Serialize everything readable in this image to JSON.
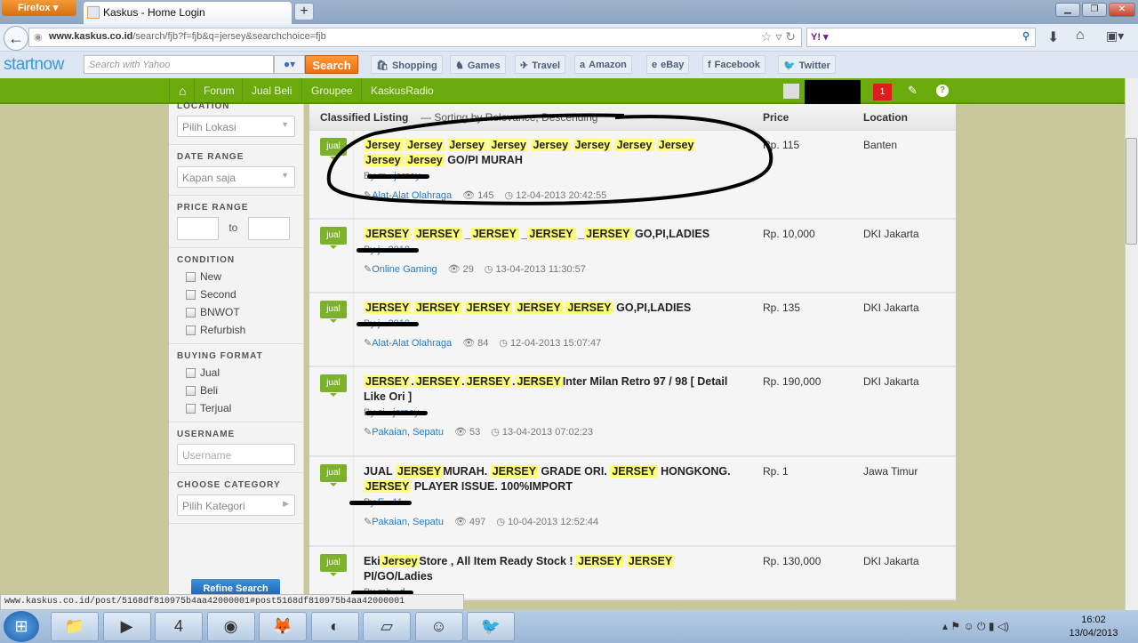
{
  "browser": {
    "menu_label": "Firefox",
    "tab_title": "Kaskus - Home Login",
    "new_tab": "+",
    "url_domain": "www.kaskus.co.id",
    "url_path": "/search/fjb?f=fjb&q=jersey&searchchoice=fjb",
    "search_engine": "Y!",
    "status_url": "www.kaskus.co.id/post/5168df810975b4aa42000001#post5168df810975b4aa42000001"
  },
  "toolbar": {
    "brand": "startnow",
    "search_placeholder": "Search with Yahoo",
    "search_button": "Search",
    "bookmarks": [
      {
        "label": "Shopping",
        "icon": "shopping-bag-icon"
      },
      {
        "label": "Games",
        "icon": "chess-knight-icon"
      },
      {
        "label": "Travel",
        "icon": "plane-icon"
      },
      {
        "label": "Amazon",
        "icon": "amazon-icon"
      },
      {
        "label": "eBay",
        "icon": "ebay-icon"
      },
      {
        "label": "Facebook",
        "icon": "facebook-icon"
      },
      {
        "label": "Twitter",
        "icon": "twitter-icon"
      }
    ]
  },
  "site_nav": {
    "items": [
      "Forum",
      "Jual Beli",
      "Groupee",
      "KaskusRadio"
    ],
    "notification_count": "1",
    "accent": "#6aaa0d"
  },
  "sidebar": {
    "location": {
      "label": "LOCATION",
      "value": "Pilih Lokasi"
    },
    "date_range": {
      "label": "DATE RANGE",
      "value": "Kapan saja"
    },
    "price_range": {
      "label": "PRICE RANGE",
      "to": "to",
      "min": "",
      "max": ""
    },
    "condition": {
      "label": "CONDITION",
      "options": [
        "New",
        "Second",
        "BNWOT",
        "Refurbish"
      ]
    },
    "buying_format": {
      "label": "BUYING FORMAT",
      "options": [
        "Jual",
        "Beli",
        "Terjual"
      ]
    },
    "username": {
      "label": "USERNAME",
      "placeholder": "Username"
    },
    "category": {
      "label": "CHOOSE CATEGORY",
      "value": "Pilih Kategori"
    },
    "refine_button": "Refine Search"
  },
  "listing": {
    "header": {
      "title": "Classified Listing",
      "sorting": "— Sorting by Relevance, Descending",
      "price": "Price",
      "location": "Location"
    },
    "by_label": "By",
    "items": [
      {
        "badge": "jual",
        "title": [
          {
            "t": "Jersey",
            "h": true
          },
          {
            "t": " "
          },
          {
            "t": "Jersey",
            "h": true
          },
          {
            "t": " "
          },
          {
            "t": "Jersey",
            "h": true
          },
          {
            "t": " "
          },
          {
            "t": "Jersey",
            "h": true
          },
          {
            "t": " "
          },
          {
            "t": "Jersey",
            "h": true
          },
          {
            "t": " "
          },
          {
            "t": "Jersey",
            "h": true
          },
          {
            "t": " "
          },
          {
            "t": "Jersey",
            "h": true
          },
          {
            "t": " "
          },
          {
            "t": "Jersey",
            "h": true
          },
          {
            "t": " "
          },
          {
            "t": "Jersey",
            "h": true
          },
          {
            "t": " "
          },
          {
            "t": "Jersey",
            "h": true
          },
          {
            "t": " GO/PI MURAH"
          }
        ],
        "seller": "m...jersey",
        "category": "Alat-Alat Olahraga",
        "views": "145",
        "date": "12-04-2013 20:42:55",
        "price": "Rp. 115",
        "location": "Banten"
      },
      {
        "badge": "jual",
        "title": [
          {
            "t": "JERSEY",
            "h": true
          },
          {
            "t": " "
          },
          {
            "t": "JERSEY",
            "h": true
          },
          {
            "t": " _"
          },
          {
            "t": "JERSEY",
            "h": true
          },
          {
            "t": " _"
          },
          {
            "t": "JERSEY",
            "h": true
          },
          {
            "t": " _"
          },
          {
            "t": "JERSEY",
            "h": true
          },
          {
            "t": " GO,PI,LADIES"
          }
        ],
        "seller": "j...2010",
        "category": "Online Gaming",
        "views": "29",
        "date": "13-04-2013 11:30:57",
        "price": "Rp. 10,000",
        "location": "DKI Jakarta"
      },
      {
        "badge": "jual",
        "title": [
          {
            "t": "JERSEY",
            "h": true
          },
          {
            "t": " "
          },
          {
            "t": "JERSEY",
            "h": true
          },
          {
            "t": " "
          },
          {
            "t": "JERSEY",
            "h": true
          },
          {
            "t": " "
          },
          {
            "t": "JERSEY",
            "h": true
          },
          {
            "t": " "
          },
          {
            "t": "JERSEY",
            "h": true
          },
          {
            "t": " GO,PI,LADIES"
          }
        ],
        "seller": "j...2010",
        "category": "Alat-Alat Olahraga",
        "views": "84",
        "date": "12-04-2013 15:07:47",
        "price": "Rp. 135",
        "location": "DKI Jakarta"
      },
      {
        "badge": "jual",
        "title": [
          {
            "t": "JERSEY",
            "h": true
          },
          {
            "t": "."
          },
          {
            "t": "JERSEY",
            "h": true
          },
          {
            "t": "."
          },
          {
            "t": "JERSEY",
            "h": true
          },
          {
            "t": "."
          },
          {
            "t": "JERSEY",
            "h": true
          },
          {
            "t": "Inter Milan Retro 97 / 98 [ Detail Like Ori ]"
          }
        ],
        "seller": "ci...jersey",
        "category": "Pakaian, Sepatu",
        "views": "53",
        "date": "13-04-2013 07:02:23",
        "price": "Rp. 190,000",
        "location": "DKI Jakarta"
      },
      {
        "badge": "jual",
        "title": [
          {
            "t": "JUAL "
          },
          {
            "t": "JERSEY",
            "h": true
          },
          {
            "t": "MURAH. "
          },
          {
            "t": "JERSEY",
            "h": true
          },
          {
            "t": " GRADE ORI. "
          },
          {
            "t": "JERSEY",
            "h": true
          },
          {
            "t": " HONGKONG. "
          },
          {
            "t": "JERSEY",
            "h": true
          },
          {
            "t": " PLAYER ISSUE. 100%IMPORT"
          }
        ],
        "seller": "E...11",
        "category": "Pakaian, Sepatu",
        "views": "497",
        "date": "10-04-2013 12:52:44",
        "price": "Rp. 1",
        "location": "Jawa Timur"
      },
      {
        "badge": "jual",
        "title": [
          {
            "t": "Eki"
          },
          {
            "t": "Jersey",
            "h": true
          },
          {
            "t": "Store , All Item Ready Stock ! "
          },
          {
            "t": "JERSEY",
            "h": true
          },
          {
            "t": " "
          },
          {
            "t": "JERSEY",
            "h": true
          },
          {
            "t": " PI/GO/Ladies"
          }
        ],
        "seller": "mb...d",
        "category": "",
        "views": "",
        "date": "",
        "price": "Rp. 130,000",
        "location": "DKI Jakarta"
      }
    ]
  },
  "taskbar": {
    "apps": [
      "file-explorer-icon",
      "media-player-icon",
      "app-4-icon",
      "chrome-icon",
      "firefox-icon",
      "app-red-icon",
      "sticky-notes-icon",
      "yahoo-messenger-icon",
      "twitter-icon"
    ],
    "time": "16:02",
    "date": "13/04/2013"
  }
}
